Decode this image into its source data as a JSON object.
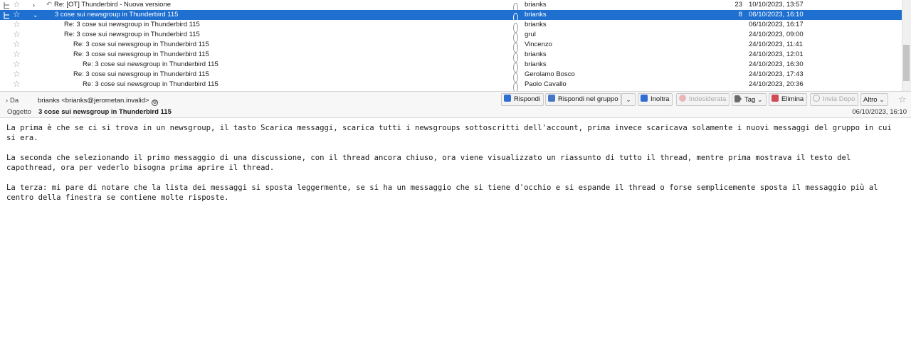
{
  "message_list": {
    "rows": [
      {
        "subject": "Re: [OT] Thunderbird - Nuova versione",
        "author": "brianks",
        "count": "23",
        "date": "10/10/2023, 13:57",
        "indent": 0,
        "twisty": "›",
        "reply_icon": true,
        "selected": false,
        "show_thread_icon": true,
        "star": "☆"
      },
      {
        "subject": "3 cose sui newsgroup in Thunderbird 115",
        "author": "brianks",
        "count": "8",
        "date": "06/10/2023, 16:10",
        "indent": 0,
        "twisty": "⌄",
        "reply_icon": false,
        "selected": true,
        "show_thread_icon": true,
        "star": "☆"
      },
      {
        "subject": "Re: 3 cose sui newsgroup in Thunderbird 115",
        "author": "brianks",
        "count": "",
        "date": "06/10/2023, 16:17",
        "indent": 1,
        "twisty": "",
        "reply_icon": false,
        "selected": false,
        "show_thread_icon": false,
        "star": "☆"
      },
      {
        "subject": "Re: 3 cose sui newsgroup in Thunderbird 115",
        "author": "grul",
        "count": "",
        "date": "24/10/2023, 09:00",
        "indent": 1,
        "twisty": "",
        "reply_icon": false,
        "selected": false,
        "show_thread_icon": false,
        "star": "☆"
      },
      {
        "subject": "Re: 3 cose sui newsgroup in Thunderbird 115",
        "author": "Vincenzo",
        "count": "",
        "date": "24/10/2023, 11:41",
        "indent": 2,
        "twisty": "",
        "reply_icon": false,
        "selected": false,
        "show_thread_icon": false,
        "star": "☆"
      },
      {
        "subject": "Re: 3 cose sui newsgroup in Thunderbird 115",
        "author": "brianks",
        "count": "",
        "date": "24/10/2023, 12:01",
        "indent": 2,
        "twisty": "",
        "reply_icon": false,
        "selected": false,
        "show_thread_icon": false,
        "star": "☆"
      },
      {
        "subject": "Re: 3 cose sui newsgroup in Thunderbird 115",
        "author": "brianks",
        "count": "",
        "date": "24/10/2023, 16:30",
        "indent": 3,
        "twisty": "",
        "reply_icon": false,
        "selected": false,
        "show_thread_icon": false,
        "star": "☆"
      },
      {
        "subject": "Re: 3 cose sui newsgroup in Thunderbird 115",
        "author": "Gerolamo Bosco",
        "count": "",
        "date": "24/10/2023, 17:43",
        "indent": 2,
        "twisty": "",
        "reply_icon": false,
        "selected": false,
        "show_thread_icon": false,
        "star": "☆"
      },
      {
        "subject": "Re: 3 cose sui newsgroup in Thunderbird 115",
        "author": "Paolo Cavallo",
        "count": "",
        "date": "24/10/2023, 20:36",
        "indent": 3,
        "twisty": "",
        "reply_icon": false,
        "selected": false,
        "show_thread_icon": false,
        "star": "☆"
      }
    ]
  },
  "header": {
    "from_label": "Da",
    "from_chevron": "›",
    "from_value": "brianks <brianks@jerometan.invalid>",
    "from_contact_icon": "@",
    "subject_label": "Oggetto",
    "subject_value": "3 cose sui newsgroup in Thunderbird 115",
    "date": "06/10/2023, 16:10",
    "star": "☆",
    "buttons": {
      "reply": "Rispondi",
      "reply_group": "Rispondi nel gruppo",
      "reply_group_menu": "⌄",
      "forward": "Inoltra",
      "junk": "Indesiderata",
      "tag": "Tag",
      "tag_menu": "⌄",
      "delete": "Elimina",
      "send_later": "Invia Dopo",
      "more": "Altro",
      "more_menu": "⌄"
    }
  },
  "body": {
    "paragraphs": [
      "La prima è che se ci si trova in un newsgroup, il tasto Scarica messaggi, scarica tutti i newsgroups sottoscritti dell'account, prima invece scaricava solamente i nuovi messaggi del gruppo in cui si era.",
      "La seconda che selezionando il primo messaggio di una discussione, con il thread ancora chiuso, ora viene visualizzato un riassunto di tutto il thread, mentre prima mostrava il testo del capothread, ora per vederlo bisogna prima aprire il thread.",
      "La terza: mi pare di notare che la lista dei messaggi si sposta leggermente, se si ha un messaggio che si tiene d'occhio e si espande il thread o forse semplicemente sposta il messaggio più al centro della finestra se contiene molte risposte."
    ]
  },
  "colors": {
    "selection": "#1e6fd0",
    "accent": "#2f6fd1",
    "delete": "#d04c57"
  }
}
